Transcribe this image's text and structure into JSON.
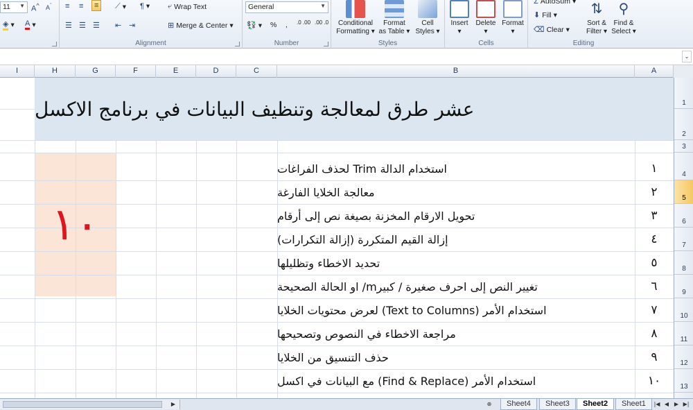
{
  "ribbon": {
    "font": {
      "size": "11",
      "grow_icon": "font-grow-icon",
      "shrink_icon": "font-shrink-icon",
      "fill_icon": "fill-color-icon",
      "font_color_icon": "font-color-icon"
    },
    "alignment": {
      "label": "Alignment",
      "wrap_text": "Wrap Text",
      "merge_center": "Merge & Center"
    },
    "number": {
      "label": "Number",
      "format": "General",
      "percent": "%",
      "comma": ",",
      "increase_decimal": ".0 .00",
      "decrease_decimal": ".00 .0"
    },
    "styles": {
      "label": "Styles",
      "conditional": [
        "Conditional",
        "Formatting"
      ],
      "format_table": [
        "Format",
        "as Table"
      ],
      "cell_styles": [
        "Cell",
        "Styles"
      ]
    },
    "cells": {
      "label": "Cells",
      "insert": "Insert",
      "delete": "Delete",
      "format": "Format"
    },
    "editing": {
      "label": "Editing",
      "autosum": "AutoSum",
      "fill": "Fill",
      "clear": "Clear",
      "sort_filter": [
        "Sort &",
        "Filter"
      ],
      "find_select": [
        "Find &",
        "Select"
      ]
    }
  },
  "columns": [
    "I",
    "H",
    "G",
    "F",
    "E",
    "D",
    "C",
    "B",
    "A"
  ],
  "rows": [
    "1",
    "2",
    "3",
    "4",
    "5",
    "6",
    "7",
    "8",
    "9",
    "10",
    "11",
    "12",
    "13"
  ],
  "sheet": {
    "title": "عشر طرق لمعالجة وتنظيف البيانات في برنامج الاكسل",
    "big_number": "١٠",
    "items": [
      {
        "num": "١",
        "text": "استخدام الدالة Trim لحذف الفراغات"
      },
      {
        "num": "٢",
        "text": "معالجة الخلايا الفارغة"
      },
      {
        "num": "٣",
        "text": "تحويل الارقام المخزنة بصيغة نص إلى أرقام"
      },
      {
        "num": "٤",
        "text": "إزالة القيم المتكررة (إزالة التكرارات)"
      },
      {
        "num": "٥",
        "text": "تحديد الاخطاء وتظليلها"
      },
      {
        "num": "٦",
        "text": "تغيير النص إلى احرف صغيرة / كبيرm/ او الحالة الصحيحة"
      },
      {
        "num": "٧",
        "text": "استخدام الأمر (Text to Columns) لعرض محتويات الخلايا"
      },
      {
        "num": "٨",
        "text": "مراجعة الاخطاء في النصوص وتصحيحها"
      },
      {
        "num": "٩",
        "text": "حذف التنسيق من الخلايا"
      },
      {
        "num": "١٠",
        "text": "استخدام الأمر (Find & Replace) مع البيانات في اكسل"
      }
    ]
  },
  "tabs": [
    "Sheet4",
    "Sheet3",
    "Sheet2",
    "Sheet1"
  ],
  "active_tab": "Sheet2",
  "colors": {
    "title_band": "#dce6f1",
    "peach": "#fbe5d6",
    "big_number": "#e0141e",
    "selected_row_header": "#f6c75d"
  }
}
